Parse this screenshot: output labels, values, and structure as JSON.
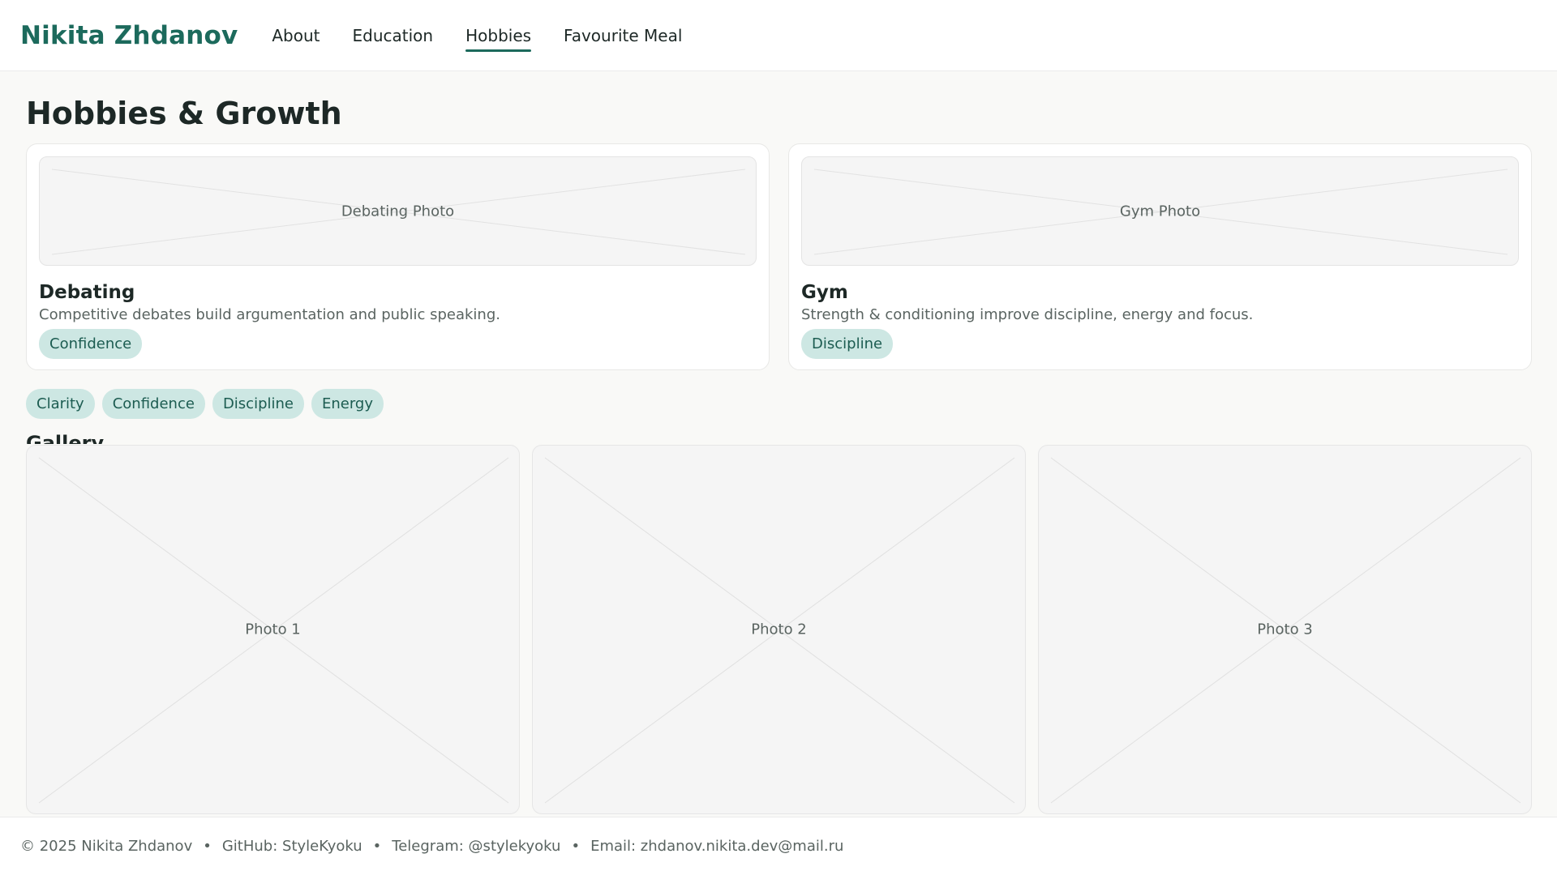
{
  "header": {
    "brand": "Nikita Zhdanov",
    "nav": [
      {
        "label": "About",
        "active": false
      },
      {
        "label": "Education",
        "active": false
      },
      {
        "label": "Hobbies",
        "active": true
      },
      {
        "label": "Favourite Meal",
        "active": false
      }
    ]
  },
  "main": {
    "title": "Hobbies & Growth",
    "cards": [
      {
        "photo_label": "Debating Photo",
        "title": "Debating",
        "description": "Competitive debates build argumentation and public speaking.",
        "chip": "Confidence"
      },
      {
        "photo_label": "Gym Photo",
        "title": "Gym",
        "description": "Strength & conditioning improve discipline, energy and focus.",
        "chip": "Discipline"
      }
    ],
    "chips": [
      "Clarity",
      "Confidence",
      "Discipline",
      "Energy"
    ],
    "gallery_title": "Gallery",
    "gallery": [
      {
        "label": "Photo 1"
      },
      {
        "label": "Photo 2"
      },
      {
        "label": "Photo 3"
      }
    ]
  },
  "footer": {
    "copyright": "© 2025 Nikita Zhdanov",
    "separator": "•",
    "github": "GitHub: StyleKyoku",
    "telegram": "Telegram: @stylekyoku",
    "email": "Email: zhdanov.nikita.dev@mail.ru"
  },
  "colors": {
    "accent": "#1c6a5c",
    "chip_bg": "#cde7e3",
    "page_bg": "#f9f9f7"
  }
}
